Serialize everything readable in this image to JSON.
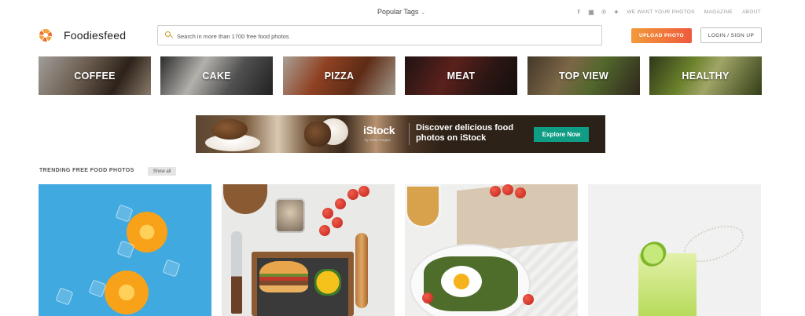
{
  "topbar": {
    "popular_tags": "Popular Tags",
    "social_icons": [
      "facebook-icon",
      "instagram-icon",
      "pinterest-icon",
      "twitter-icon"
    ],
    "links": [
      "WE WANT YOUR PHOTOS",
      "MAGAZINE",
      "ABOUT"
    ]
  },
  "header": {
    "logo_text": "Foodiesfeed",
    "search_placeholder": "Search in more than 1700 free food photos",
    "upload_label": "UPLOAD PHOTO",
    "login_label": "LOGIN / SIGN UP"
  },
  "categories": [
    "COFFEE",
    "CAKE",
    "PIZZA",
    "MEAT",
    "TOP VIEW",
    "HEALTHY"
  ],
  "banner": {
    "brand": "iStock",
    "brand_sub": "by Getty Images",
    "headline": "Discover delicious food photos on iStock",
    "cta": "Explore Now"
  },
  "trending": {
    "title": "TRENDING FREE FOOD PHOTOS",
    "show_all": "Show all"
  },
  "colors": {
    "upload_gradient_start": "#f29a3a",
    "upload_gradient_end": "#ee5a3c",
    "explore_button": "#0f9d85",
    "search_icon": "#c49a2c"
  }
}
